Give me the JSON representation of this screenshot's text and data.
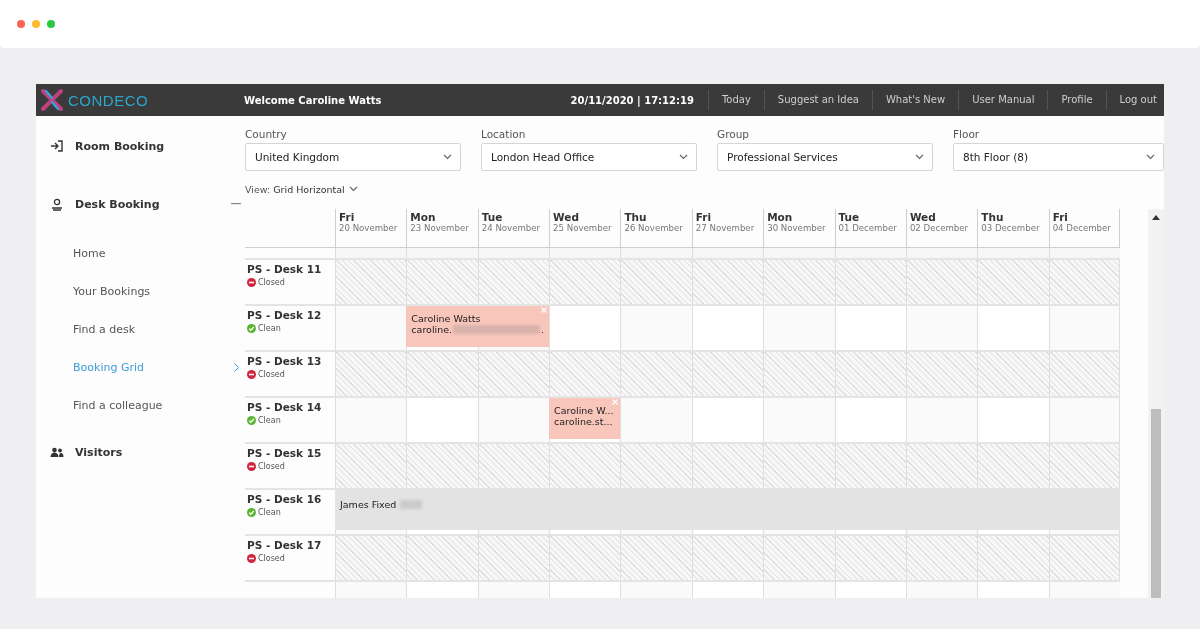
{
  "app": {
    "brand": "CONDECO",
    "welcome": "Welcome Caroline Watts",
    "datetime": "20/11/2020 | 17:12:19",
    "nav": [
      "Today",
      "Suggest an Idea",
      "What's New",
      "User Manual",
      "Profile",
      "Log out"
    ]
  },
  "sidebar": {
    "items": [
      {
        "label": "Room Booking",
        "kind": "room"
      },
      {
        "label": "Desk Booking",
        "kind": "desk",
        "expanded": true,
        "children": [
          {
            "label": "Home",
            "selected": false
          },
          {
            "label": "Your Bookings",
            "selected": false
          },
          {
            "label": "Find a desk",
            "selected": false
          },
          {
            "label": "Booking Grid",
            "selected": true
          },
          {
            "label": "Find a colleague",
            "selected": false
          }
        ]
      },
      {
        "label": "Visitors",
        "kind": "visitors"
      }
    ]
  },
  "filters": [
    {
      "label": "Country",
      "value": "United Kingdom"
    },
    {
      "label": "Location",
      "value": "London Head Office"
    },
    {
      "label": "Group",
      "value": "Professional Services"
    },
    {
      "label": "Floor",
      "value": "8th Floor (8)"
    }
  ],
  "view": {
    "label": "View:",
    "value": "Grid Horizontal"
  },
  "days": [
    {
      "day": "Fri",
      "date": "20 November"
    },
    {
      "day": "Mon",
      "date": "23 November"
    },
    {
      "day": "Tue",
      "date": "24 November"
    },
    {
      "day": "Wed",
      "date": "25 November"
    },
    {
      "day": "Thu",
      "date": "26 November"
    },
    {
      "day": "Fri",
      "date": "27 November"
    },
    {
      "day": "Mon",
      "date": "30 November"
    },
    {
      "day": "Tue",
      "date": "01 December"
    },
    {
      "day": "Wed",
      "date": "02 December"
    },
    {
      "day": "Thu",
      "date": "03 December"
    },
    {
      "day": "Fri",
      "date": "04 December"
    }
  ],
  "desks": [
    {
      "name": "PS - Desk 11",
      "status": "Closed",
      "kind": "closed"
    },
    {
      "name": "PS - Desk 12",
      "status": "Clean",
      "kind": "clean",
      "bookings": [
        {
          "kind": "desk",
          "closable": true,
          "lines": [
            {
              "text": "Caroline Watts",
              "redacted": false
            },
            {
              "text": "caroline.",
              "redacted": true,
              "tail": "."
            }
          ]
        }
      ]
    },
    {
      "name": "PS - Desk 13",
      "status": "Closed",
      "kind": "closed"
    },
    {
      "name": "PS - Desk 14",
      "status": "Clean",
      "kind": "clean",
      "bookings": [
        {
          "kind": "desk",
          "closable": true,
          "lines": [
            {
              "text": "Caroline W...",
              "redacted": false
            },
            {
              "text": "caroline.st...",
              "redacted": false
            }
          ]
        }
      ]
    },
    {
      "name": "PS - Desk 15",
      "status": "Closed",
      "kind": "closed"
    },
    {
      "name": "PS - Desk 16",
      "status": "Clean",
      "kind": "clean",
      "bookings": [
        {
          "kind": "fixed",
          "closable": false,
          "lines": [
            {
              "text": "James Fixed",
              "redacted": true
            }
          ]
        }
      ]
    },
    {
      "name": "PS - Desk 17",
      "status": "Closed",
      "kind": "closed"
    }
  ]
}
